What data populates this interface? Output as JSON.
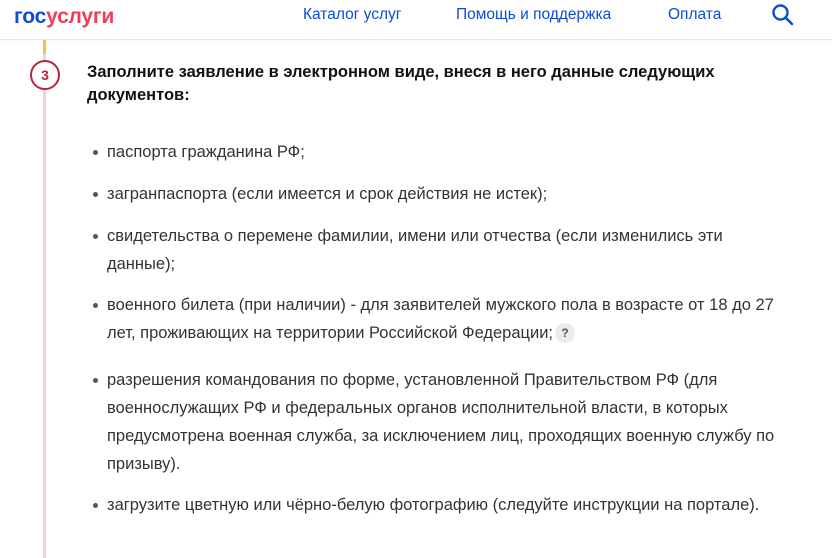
{
  "header": {
    "logo": {
      "part1": "гос",
      "part2": "услуги"
    },
    "nav": [
      {
        "label": "Каталог услуг"
      },
      {
        "label": "Помощь и поддержка"
      },
      {
        "label": "Оплата"
      }
    ],
    "search_icon": "search-icon"
  },
  "colors": {
    "brand_blue": "#0d4cd3",
    "brand_red": "#ee3f58",
    "step_accent": "#b8253d",
    "timeline_done": "#f3c245",
    "timeline_pending": "#ecd4da"
  },
  "step": {
    "number": "3",
    "title": "Заполните заявление в электронном виде, внеся в него данные следующих документов:",
    "items": [
      {
        "text": "паспорта гражданина РФ;"
      },
      {
        "text": "загранпаспорта (если имеется и срок действия не истек);"
      },
      {
        "text": "свидетельства о перемене фамилии, имени или отчества (если изменились эти данные);"
      },
      {
        "text": "военного билета (при наличии) - для заявителей мужского пола в возрасте от 18 до 27 лет, проживающих на территории Российской Федерации;",
        "help_label": "?"
      },
      {
        "text": "разрешения командования по форме, установленной Правительством РФ (для военнослужащих РФ и федеральных органов исполнительной власти, в которых предусмотрена военная служба, за исключением лиц, проходящих военную службу по призыву)."
      },
      {
        "text": "загрузите цветную или чёрно-белую фотографию (следуйте инструкции на портале)."
      }
    ]
  }
}
